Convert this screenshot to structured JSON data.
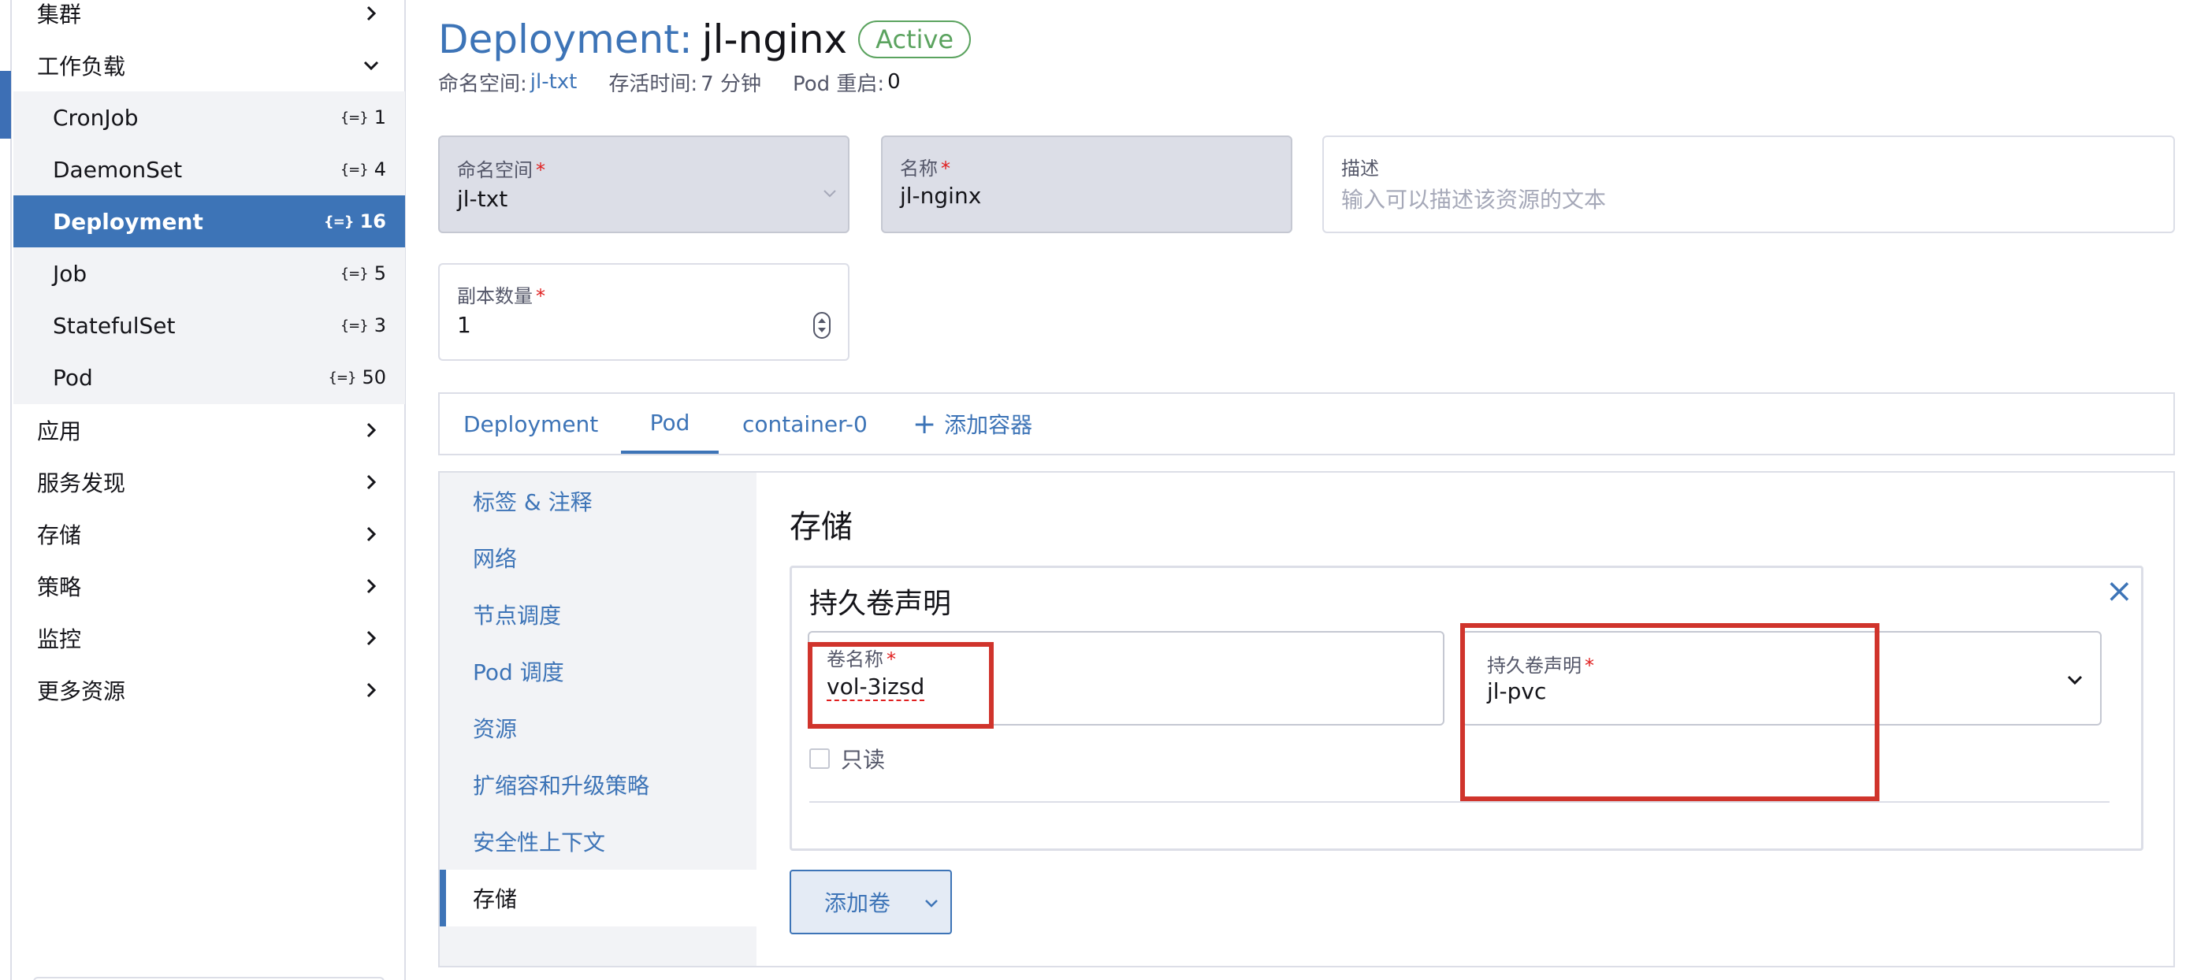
{
  "sidebar": {
    "groups": {
      "cluster": "集群",
      "workload": "工作负载",
      "apps": "应用",
      "service_discovery": "服务发现",
      "storage": "存储",
      "policy": "策略",
      "monitoring": "监控",
      "more": "更多资源"
    },
    "items": [
      {
        "label": "CronJob",
        "count": "1"
      },
      {
        "label": "DaemonSet",
        "count": "4"
      },
      {
        "label": "Deployment",
        "count": "16",
        "active": true
      },
      {
        "label": "Job",
        "count": "5"
      },
      {
        "label": "StatefulSet",
        "count": "3"
      },
      {
        "label": "Pod",
        "count": "50"
      }
    ],
    "count_icon": "namespace-braces-icon"
  },
  "header": {
    "kind": "Deployment:",
    "name": "jl-nginx",
    "status": "Active",
    "meta": {
      "namespace_label": "命名空间:",
      "namespace_value": "jl-txt",
      "age_label": "存活时间:",
      "age_value": "7 分钟",
      "restarts_label": "Pod 重启:",
      "restarts_value": "0"
    }
  },
  "form": {
    "namespace": {
      "label": "命名空间",
      "value": "jl-txt"
    },
    "name": {
      "label": "名称",
      "value": "jl-nginx"
    },
    "description": {
      "label": "描述",
      "placeholder": "输入可以描述该资源的文本"
    },
    "replicas": {
      "label": "副本数量",
      "value": "1"
    },
    "required_mark": "*"
  },
  "tabs": {
    "deployment": "Deployment",
    "pod": "Pod",
    "container": "container-0",
    "add_container": "添加容器"
  },
  "side_tabs": {
    "labels": "标签 & 注释",
    "network": "网络",
    "node_scheduling": "节点调度",
    "pod_scheduling": "Pod 调度",
    "resources": "资源",
    "scaling": "扩缩容和升级策略",
    "security": "安全性上下文",
    "storage": "存储"
  },
  "storage": {
    "section_title": "存储",
    "volume": {
      "title": "持久卷声明",
      "volume_name_label": "卷名称",
      "volume_name_value": "vol-3izsd",
      "pvc_label": "持久卷声明",
      "pvc_value": "jl-pvc",
      "readonly_label": "只读",
      "close_symbol": "×"
    },
    "add_volume": "添加卷"
  },
  "colors": {
    "accent": "#3d74b7",
    "active_badge": "#5ba35f",
    "required": "#e01f1f",
    "highlight": "#d0342c"
  }
}
